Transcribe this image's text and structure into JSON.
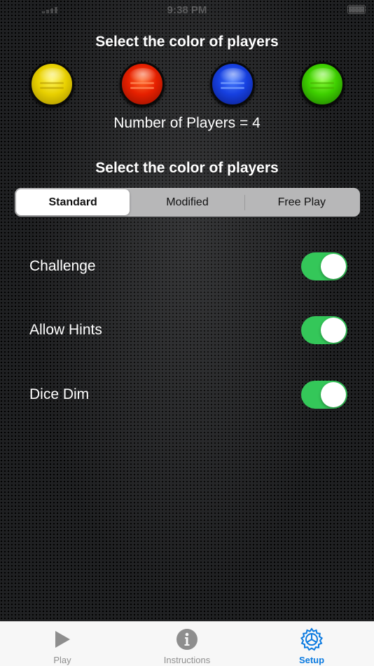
{
  "status_bar": {
    "time": "9:38 PM"
  },
  "players": {
    "heading": "Select the color of players",
    "balls": [
      {
        "name": "yellow",
        "color": "#e8d000"
      },
      {
        "name": "red",
        "color": "#e62000"
      },
      {
        "name": "blue",
        "color": "#1640e0"
      },
      {
        "name": "green",
        "color": "#3ecf00"
      }
    ],
    "count_text": "Number of Players = 4"
  },
  "mode": {
    "heading": "Select the color of players",
    "options": [
      "Standard",
      "Modified",
      "Free Play"
    ],
    "selected": "Standard"
  },
  "settings": [
    {
      "label": "Challenge",
      "enabled": true
    },
    {
      "label": "Allow Hints",
      "enabled": true
    },
    {
      "label": "Dice Dim",
      "enabled": true
    }
  ],
  "colors": {
    "toggle_on": "#34c759",
    "tab_active": "#0a7ae0",
    "tab_inactive": "#8e8e8e"
  },
  "tab_bar": {
    "tabs": [
      {
        "label": "Play",
        "icon": "play-icon",
        "active": false
      },
      {
        "label": "Instructions",
        "icon": "info-icon",
        "active": false
      },
      {
        "label": "Setup",
        "icon": "gear-icon",
        "active": true
      }
    ]
  }
}
